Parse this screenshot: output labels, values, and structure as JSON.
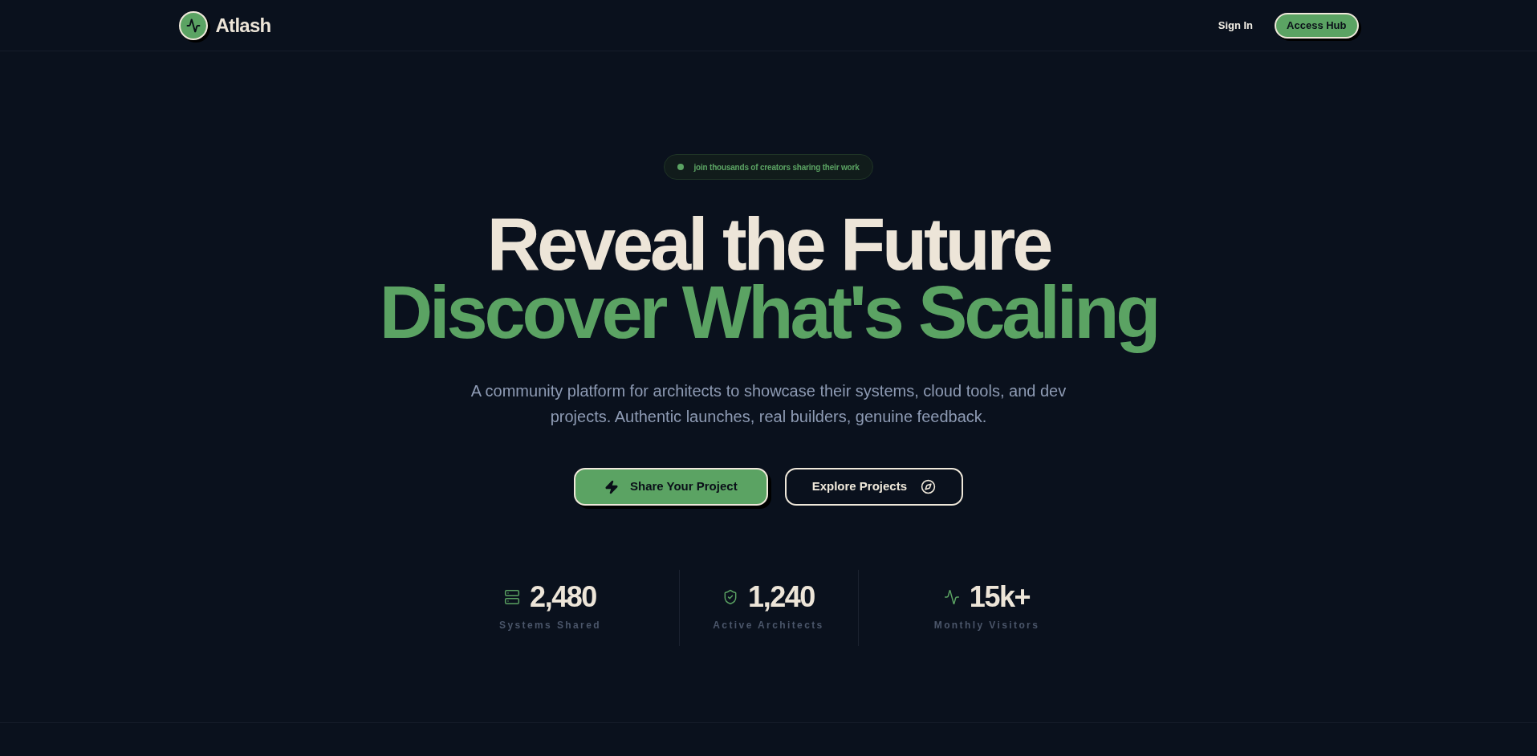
{
  "header": {
    "logo": {
      "name": "Atlash"
    },
    "nav": [
      {
        "label": "Sign In",
        "kind": "link"
      },
      {
        "label": "Access Hub",
        "kind": "button"
      }
    ]
  },
  "hero": {
    "badge": {
      "text": "join thousands of creators sharing their work"
    },
    "title": [
      {
        "text": "Reveal the Future",
        "kind": "plain"
      },
      {
        "text": "Discover What's Scaling",
        "kind": "accent"
      }
    ],
    "description": "A community platform for architects to showcase their systems, cloud tools, and dev projects. Authentic launches, real builders, genuine feedback.",
    "buttons": [
      {
        "label": "Share Your Project",
        "kind": "primary"
      },
      {
        "label": "Explore Projects",
        "kind": "secondary"
      }
    ]
  },
  "stats": [
    {
      "value": "2,480",
      "label": "Systems Shared"
    },
    {
      "value": "1,240",
      "label": "Active Architects"
    },
    {
      "value": "15k+",
      "label": "Monthly Visitors"
    }
  ]
}
